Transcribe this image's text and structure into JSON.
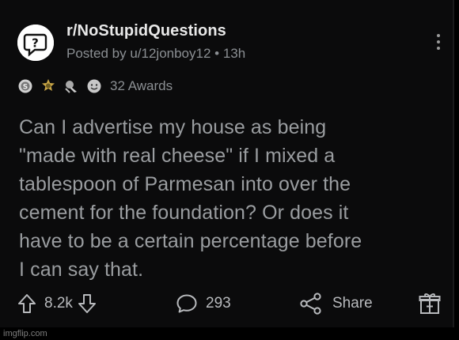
{
  "post": {
    "subreddit": "r/NoStupidQuestions",
    "meta": "Posted by u/12jonboy12 • 13h",
    "awards_label": "32 Awards",
    "body": "Can I advertise my house as being\n\"made with real cheese\" if I mixed a\ntablespoon of Parmesan into over the\ncement for the foundation? Or does it\nhave to be a certain percentage before\nI can say that."
  },
  "actions": {
    "upvotes": "8.2k",
    "comments": "293",
    "share_label": "Share"
  },
  "icons": {
    "subreddit": "question-mark-icon",
    "more": "kebab-menu-icon",
    "awards": [
      "silver-award-icon",
      "gold-award-icon",
      "helpful-award-icon",
      "wholesome-award-icon"
    ],
    "upvote": "arrow-up-icon",
    "downvote": "arrow-down-icon",
    "comment": "comment-bubble-icon",
    "share": "share-icon",
    "gift": "gift-award-icon"
  },
  "watermark": "imgflip.com",
  "colors": {
    "background": "#0b0b0c",
    "body_text": "#9a9da0",
    "meta_text": "#8b8f93"
  }
}
